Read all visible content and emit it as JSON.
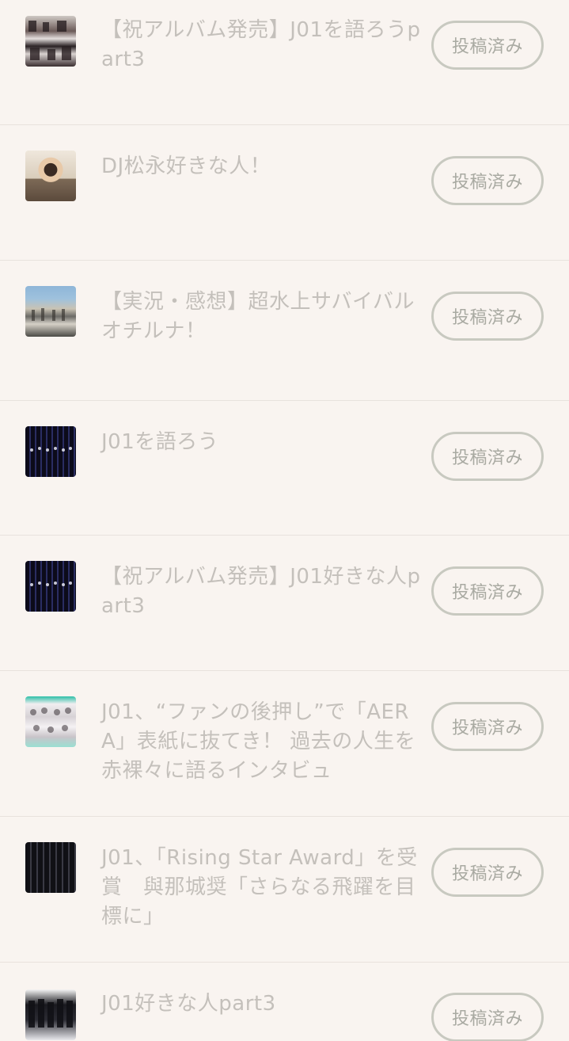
{
  "posted_label": "投稿済み",
  "items": [
    {
      "title": "【祝アルバム発売】J01を語ろうpart3",
      "thumb": "group-photo-icon"
    },
    {
      "title": "DJ松永好きな人！",
      "thumb": "portrait-photo-icon"
    },
    {
      "title": "【実況・感想】超水上サバイバル　オチルナ！",
      "thumb": "outdoor-photo-icon"
    },
    {
      "title": "J01を語ろう",
      "thumb": "stage-photo-icon"
    },
    {
      "title": "【祝アルバム発売】J01好きな人part3",
      "thumb": "stage-photo-icon"
    },
    {
      "title": "J01、“ファンの後押し”で「AERA」表紙に抜てき！ 過去の人生を赤裸々に語るインタビュ",
      "thumb": "magazine-cover-icon"
    },
    {
      "title": "J01、「Rising Star Award」を受賞　與那城奨「さらなる飛躍を目標に」",
      "thumb": "award-photo-icon"
    },
    {
      "title": "J01好きな人part3",
      "thumb": "group-photo-icon"
    }
  ]
}
